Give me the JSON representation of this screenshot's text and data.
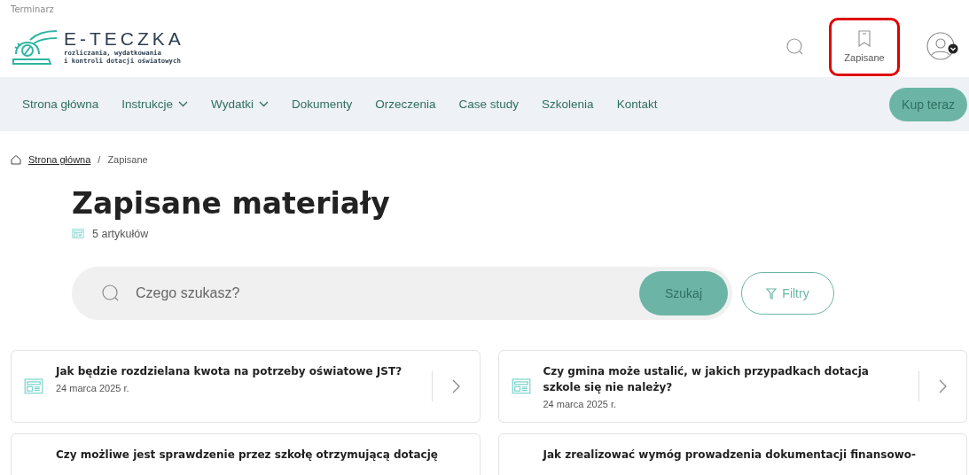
{
  "top_link": "Terminarz",
  "logo": {
    "name": "E-TECZKA",
    "tagline_1": "rozliczania, wydatkowania",
    "tagline_2": "i kontroli dotacji oświatowych"
  },
  "header": {
    "saved_label": "Zapisane",
    "saved_highlighted": true
  },
  "nav": {
    "items": [
      {
        "label": "Strona główna",
        "has_menu": false
      },
      {
        "label": "Instrukcje",
        "has_menu": true
      },
      {
        "label": "Wydatki",
        "has_menu": true
      },
      {
        "label": "Dokumenty",
        "has_menu": false
      },
      {
        "label": "Orzeczenia",
        "has_menu": false
      },
      {
        "label": "Case study",
        "has_menu": false
      },
      {
        "label": "Szkolenia",
        "has_menu": false
      },
      {
        "label": "Kontakt",
        "has_menu": false
      }
    ],
    "cta": "Kup teraz"
  },
  "breadcrumb": [
    "Strona główna",
    "Zapisane"
  ],
  "breadcrumb_separator": "/",
  "title": "Zapisane materiały",
  "count": "5 artykułów",
  "search": {
    "placeholder": "Czego szukasz?",
    "button": "Szukaj",
    "filters": "Filtry"
  },
  "articles": [
    {
      "title": "Jak będzie rozdzielana kwota na potrzeby oświatowe JST?",
      "date": "24 marca 2025 r."
    },
    {
      "title": "Czy gmina może ustalić, w jakich przypadkach dotacja szkole się nie należy?",
      "date": "24 marca 2025 r."
    },
    {
      "title": "Czy możliwe jest sprawdzenie przez szkołę otrzymującą dotację"
    },
    {
      "title": "Jak zrealizować wymóg prowadzenia dokumentacji finansowo-"
    }
  ]
}
